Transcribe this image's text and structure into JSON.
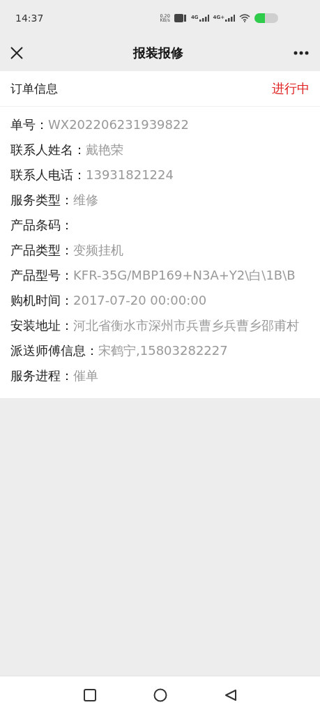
{
  "status_bar": {
    "time": "14:37",
    "net_speed": "0.20",
    "net_unit": "KB/s",
    "sim_1": "4G",
    "sim_2": "4G+"
  },
  "nav_bar": {
    "title": "报装报修"
  },
  "order": {
    "heading": "订单信息",
    "status": "进行中",
    "fields": [
      {
        "label": "单号：",
        "value": "WX202206231939822"
      },
      {
        "label": "联系人姓名：",
        "value": "戴艳荣"
      },
      {
        "label": "联系人电话：",
        "value": "13931821224"
      },
      {
        "label": "服务类型：",
        "value": "维修"
      },
      {
        "label": "产品条码："
      },
      {
        "label": "产品类型：",
        "value": "变频挂机"
      },
      {
        "label": "产品型号：",
        "value": "KFR-35G/MBP169+N3A+Y2\\白\\1B\\B"
      },
      {
        "label": "购机时间：",
        "value": "2017-07-20 00:00:00"
      },
      {
        "label": "安装地址：",
        "value": "河北省衡水市深州市兵曹乡兵曹乡邵甫村"
      },
      {
        "label": "派送师傅信息：",
        "value": "宋鹤宁,15803282227"
      },
      {
        "label": "服务进程：",
        "value": "催单"
      }
    ]
  }
}
